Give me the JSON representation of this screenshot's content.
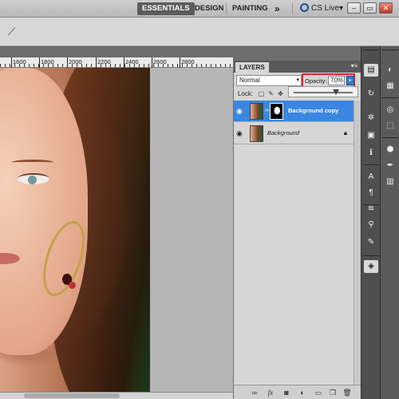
{
  "workspace": {
    "essentials": "ESSENTIALS",
    "design": "DESIGN",
    "painting": "PAINTING",
    "more": "»",
    "cs_live": "CS Live",
    "cs_live_arrow": "▾"
  },
  "window_controls": {
    "minimize": "–",
    "restore": "▭",
    "close": "✕"
  },
  "ruler": {
    "labels": [
      "1600",
      "1800",
      "2000",
      "2200",
      "2400",
      "2600",
      "2800"
    ]
  },
  "layers_panel": {
    "tab": "LAYERS",
    "menu": "▾≡",
    "blend_mode": "Normal",
    "blend_arrow": "▾",
    "opacity_label": "Opacity:",
    "opacity_value": "70%",
    "opacity_dropdown": "▸",
    "lock_label": "Lock:",
    "layers": [
      {
        "name": "Background copy",
        "selected": true,
        "has_mask": true
      },
      {
        "name": "Background",
        "selected": false,
        "locked": true
      }
    ],
    "footer_icons": [
      "link-icon",
      "fx-icon",
      "mask-icon",
      "adjustment-icon",
      "folder-icon",
      "new-layer-icon",
      "trash-icon"
    ]
  },
  "colors": {
    "selected_layer": "#3b86e0",
    "opacity_highlight": "#e0262b",
    "active_workspace": "#5c5c5c"
  }
}
